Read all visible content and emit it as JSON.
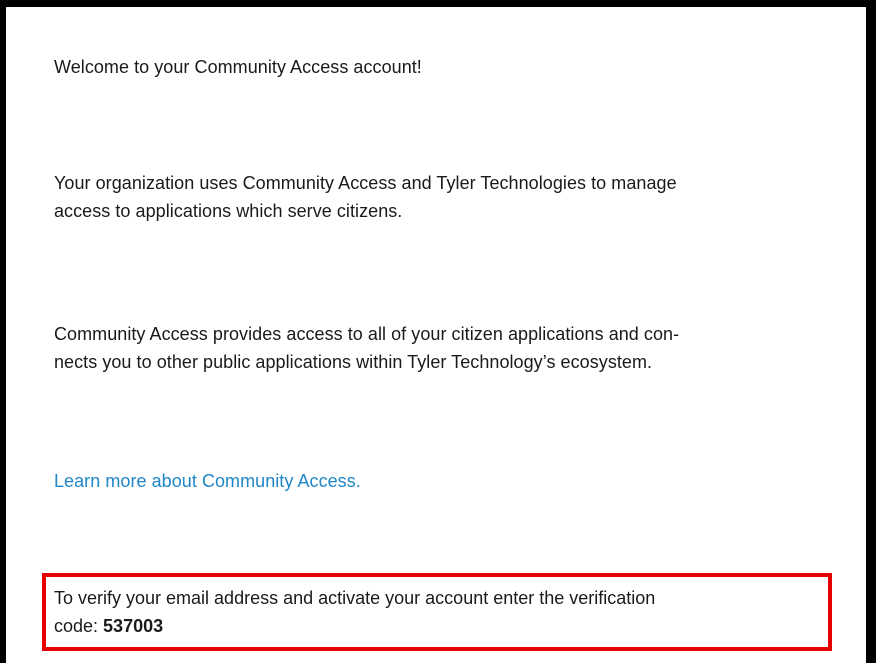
{
  "email": {
    "welcome": "Welcome to your Community Access account!",
    "paragraph_org_line1": "Your organization uses Community Access and Tyler Technologies to manage",
    "paragraph_org_line2": "access to applications which serve citizens.",
    "paragraph_access_line1": "Community Access provides access to all of your citizen applications and con-",
    "paragraph_access_line2": "nects you to other public applications within Tyler Technology’s ecosystem.",
    "learn_more_link": "Learn more about Community Access.",
    "verify_line1": "To verify your email address and activate your account enter the verification",
    "verify_line2_prefix": "code: ",
    "verification_code": "537003"
  },
  "colors": {
    "link": "#1f86c8",
    "highlight_border": "#e60000",
    "frame_border": "#000000"
  }
}
